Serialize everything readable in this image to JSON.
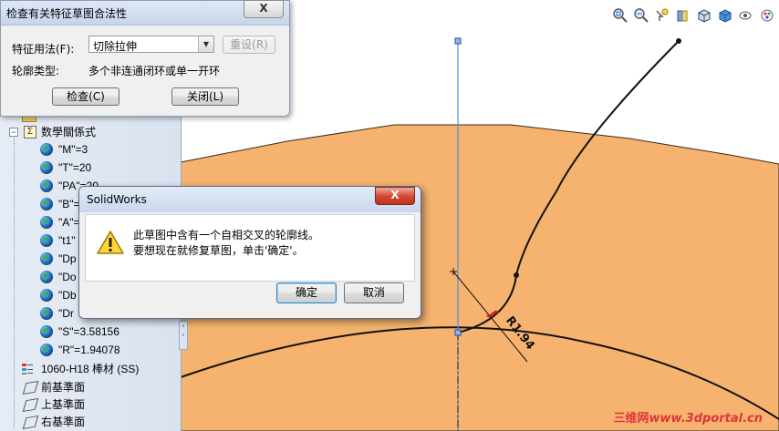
{
  "check_dialog": {
    "title": "检查有关特征草图合法性",
    "close_label": "X",
    "feature_usage_label": "特征用法(F):",
    "feature_usage_value": "切除拉伸",
    "reset_label": "重设(R)",
    "contour_type_label": "轮廓类型:",
    "contour_type_value": "多个非连通闭环或单一开环",
    "check_label": "检查(C)",
    "close_button_label": "关闭(L)"
  },
  "message_dialog": {
    "title": "SolidWorks",
    "close_label": "X",
    "line1": "此草图中含有一个自相交叉的轮廓线。",
    "line2": "要想现在就修复草图，单击'确定'。",
    "ok_label": "确定",
    "cancel_label": "取消"
  },
  "feature_tree": {
    "partial_top": "...",
    "equations_label": "数學關係式",
    "equations": [
      "\"M\"=3",
      "\"T\"=20",
      "\"PA\"=20",
      "\"B\"=",
      "\"A\"=",
      "\"t1\"",
      "\"Dp",
      "\"Do",
      "\"Db",
      "\"Dr",
      "\"S\"=3.58156",
      "\"R\"=1.94078"
    ],
    "material_label": "1060-H18 棒材 (SS)",
    "planes": [
      "前基準面",
      "上基準面",
      "右基準面"
    ]
  },
  "drawing": {
    "dimension_label": "R1.94",
    "part_color": "#f5b36f",
    "centerline_color": "#4a90d9"
  },
  "watermark": {
    "prefix": "三维网",
    "url": "www.3dportal.cn"
  },
  "icons": [
    "zoom-to-fit-icon",
    "zoom-area-icon",
    "previous-view-icon",
    "section-view-icon",
    "view-orientation-icon",
    "display-style-icon",
    "hide-show-items-icon",
    "edit-appearance-icon"
  ]
}
